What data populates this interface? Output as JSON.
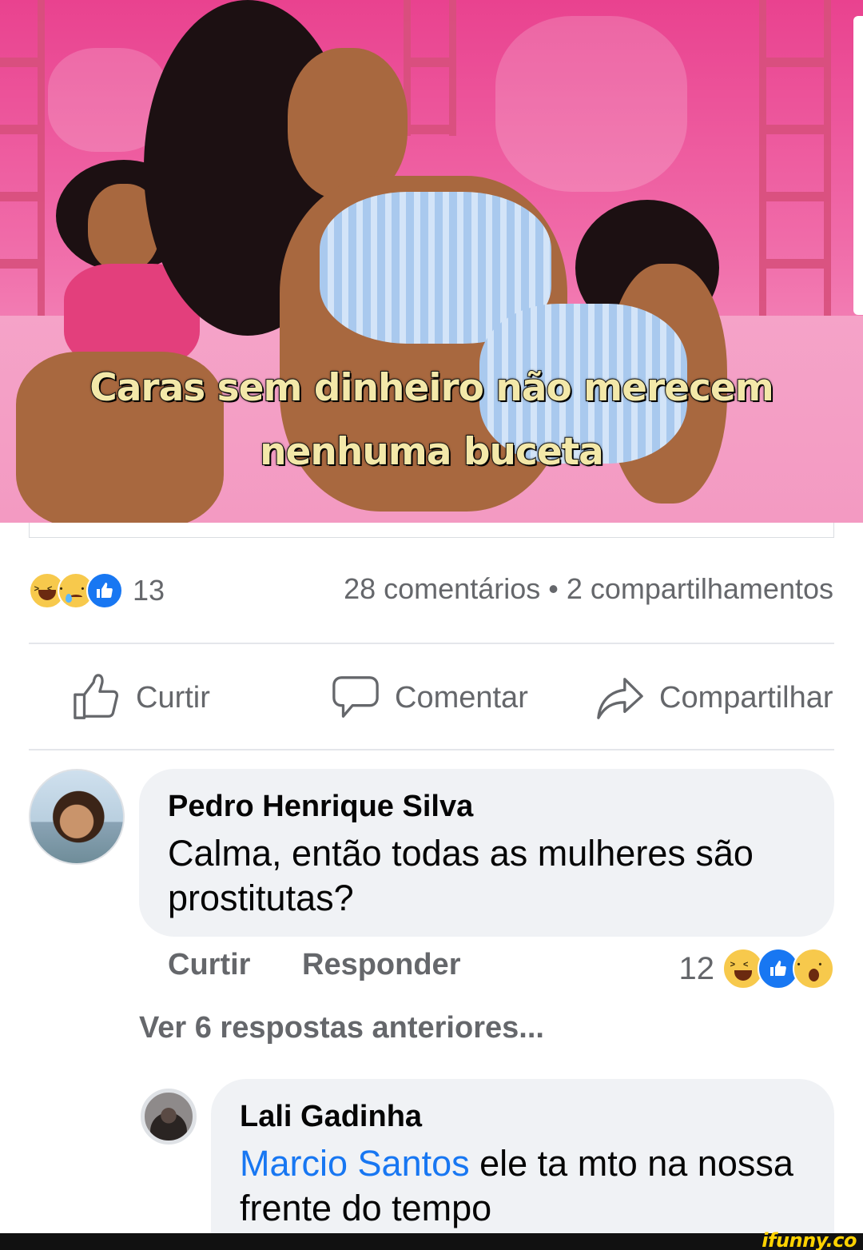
{
  "meme": {
    "caption_line_1": "Caras sem dinheiro não merecem",
    "caption_line_2": "nenhuma buceta"
  },
  "post": {
    "reactions": [
      "haha-icon",
      "sad-icon",
      "like-icon"
    ],
    "reaction_count": "13",
    "stats": "28 comentários • 2 compartilhamentos"
  },
  "actions": {
    "like_label": "Curtir",
    "comment_label": "Comentar",
    "share_label": "Compartilhar"
  },
  "comments": [
    {
      "author": "Pedro Henrique Silva",
      "text": "Calma, então todas as mulheres são prostitutas?",
      "like_label": "Curtir",
      "reply_label": "Responder",
      "reaction_count": "12",
      "reactions": [
        "haha-icon",
        "like-icon",
        "wow-icon"
      ]
    }
  ],
  "view_replies": "Ver 6 respostas anteriores...",
  "reply": {
    "author": "Lali Gadinha",
    "mention": "Marcio Santos",
    "text": " ele ta mto na nossa frente do tempo"
  },
  "watermark": "ifunny.co",
  "colors": {
    "facebook_blue": "#1877f2",
    "secondary_text": "#65676b",
    "bubble_bg": "#f0f2f5",
    "watermark_yellow": "#ffd200"
  }
}
